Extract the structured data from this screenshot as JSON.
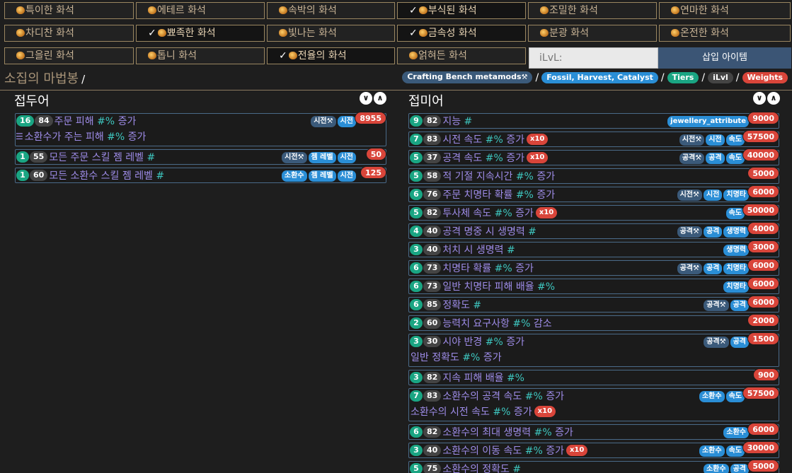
{
  "fossils": [
    {
      "label": "특이한 화석",
      "selected": false
    },
    {
      "label": "에테르 화석",
      "selected": false
    },
    {
      "label": "속박의 화석",
      "selected": false
    },
    {
      "label": "부식된 화석",
      "selected": true
    },
    {
      "label": "조밀한 화석",
      "selected": false
    },
    {
      "label": "연마한 화석",
      "selected": false
    },
    {
      "label": "차디찬 화석",
      "selected": false
    },
    {
      "label": "뾰족한 화석",
      "selected": true
    },
    {
      "label": "빛나는 화석",
      "selected": false
    },
    {
      "label": "금속성 화석",
      "selected": true
    },
    {
      "label": "분광 화석",
      "selected": false
    },
    {
      "label": "온전한 화석",
      "selected": false
    },
    {
      "label": "그을린 화석",
      "selected": false
    },
    {
      "label": "톱니 화석",
      "selected": false
    },
    {
      "label": "전율의 화석",
      "selected": true
    },
    {
      "label": "얽혀든 화석",
      "selected": false
    }
  ],
  "ilvl_placeholder": "iLvL:",
  "insert_label": "삽입 아이템",
  "item_title": "소집의 마법봉",
  "title_sep": "/",
  "breadcrumbs": [
    {
      "label": "Crafting Bench metamods",
      "color": "dark",
      "hammer": true
    },
    {
      "label": "Fossil, Harvest, Catalyst",
      "color": "blue"
    },
    {
      "label": "Tiers",
      "color": "teal"
    },
    {
      "label": "iLvl",
      "color": "gray"
    },
    {
      "label": "Weights",
      "color": "red"
    }
  ],
  "prefix_title": "접두어",
  "suffix_title": "접미어",
  "icons": {
    "expand": "chevron-down-icon",
    "collapse": "chevron-up-icon",
    "fossil": "fossil-icon",
    "hammer": "hammer-icon",
    "list": "list-icon"
  },
  "prefixes": [
    {
      "level": "16",
      "ilvl": "84",
      "lines": [
        {
          "pre": "주문 피해",
          "stat": "#%",
          "post": "증가"
        },
        {
          "pre": "소환수가 주는 피해",
          "stat": "#%",
          "post": "증가",
          "list": true
        }
      ],
      "tags": [
        {
          "t": "시전",
          "dark": true,
          "hammer": true
        },
        {
          "t": "시전"
        }
      ],
      "weight": "8955"
    },
    {
      "level": "1",
      "ilvl": "55",
      "lines": [
        {
          "pre": "모든 주문 스킬 젬 레벨",
          "stat": "#",
          "post": ""
        }
      ],
      "tags": [
        {
          "t": "시전",
          "dark": true,
          "hammer": true
        },
        {
          "t": "젬 레벨"
        },
        {
          "t": "시전"
        }
      ],
      "weight": "50"
    },
    {
      "level": "1",
      "ilvl": "60",
      "lines": [
        {
          "pre": "모든 소환수 스킬 젬 레벨",
          "stat": "#",
          "post": ""
        }
      ],
      "tags": [
        {
          "t": "소환수"
        },
        {
          "t": "젬 레벨"
        },
        {
          "t": "시전"
        }
      ],
      "weight": "125"
    }
  ],
  "suffixes": [
    {
      "level": "9",
      "ilvl": "82",
      "lines": [
        {
          "pre": "지능",
          "stat": "#",
          "post": ""
        }
      ],
      "tags": [
        {
          "t": "jewellery_attribute"
        }
      ],
      "weight": "9000"
    },
    {
      "level": "7",
      "ilvl": "83",
      "lines": [
        {
          "pre": "시전 속도",
          "stat": "#%",
          "post": "증가",
          "x10": "x10"
        }
      ],
      "tags": [
        {
          "t": "시전",
          "dark": true,
          "hammer": true
        },
        {
          "t": "시전"
        },
        {
          "t": "속도"
        }
      ],
      "weight": "57500"
    },
    {
      "level": "5",
      "ilvl": "37",
      "lines": [
        {
          "pre": "공격 속도",
          "stat": "#%",
          "post": "증가",
          "x10": "x10"
        }
      ],
      "tags": [
        {
          "t": "공격",
          "dark": true,
          "hammer": true
        },
        {
          "t": "공격"
        },
        {
          "t": "속도"
        }
      ],
      "weight": "40000"
    },
    {
      "level": "5",
      "ilvl": "58",
      "lines": [
        {
          "pre": "적 기절 지속시간",
          "stat": "#%",
          "post": "증가"
        }
      ],
      "tags": [],
      "weight": "5000"
    },
    {
      "level": "6",
      "ilvl": "76",
      "lines": [
        {
          "pre": "주문 치명타 확률",
          "stat": "#%",
          "post": "증가"
        }
      ],
      "tags": [
        {
          "t": "시전",
          "dark": true,
          "hammer": true
        },
        {
          "t": "시전"
        },
        {
          "t": "치명타"
        }
      ],
      "weight": "6000"
    },
    {
      "level": "5",
      "ilvl": "82",
      "lines": [
        {
          "pre": "투사체 속도",
          "stat": "#%",
          "post": "증가",
          "x10": "x10"
        }
      ],
      "tags": [
        {
          "t": "속도"
        }
      ],
      "weight": "50000"
    },
    {
      "level": "4",
      "ilvl": "40",
      "lines": [
        {
          "pre": "공격 명중 시 생명력",
          "stat": "#",
          "post": ""
        }
      ],
      "tags": [
        {
          "t": "공격",
          "dark": true,
          "hammer": true
        },
        {
          "t": "공격"
        },
        {
          "t": "생명력"
        }
      ],
      "weight": "4000"
    },
    {
      "level": "3",
      "ilvl": "40",
      "lines": [
        {
          "pre": "처치 시 생명력",
          "stat": "#",
          "post": ""
        }
      ],
      "tags": [
        {
          "t": "생명력"
        }
      ],
      "weight": "3000"
    },
    {
      "level": "6",
      "ilvl": "73",
      "lines": [
        {
          "pre": "치명타 확률",
          "stat": "#%",
          "post": "증가"
        }
      ],
      "tags": [
        {
          "t": "공격",
          "dark": true,
          "hammer": true
        },
        {
          "t": "공격"
        },
        {
          "t": "치명타"
        }
      ],
      "weight": "6000"
    },
    {
      "level": "6",
      "ilvl": "73",
      "lines": [
        {
          "pre": "일반 치명타 피해 배율",
          "stat": "#%",
          "post": ""
        }
      ],
      "tags": [
        {
          "t": "치명타"
        }
      ],
      "weight": "6000"
    },
    {
      "level": "6",
      "ilvl": "85",
      "lines": [
        {
          "pre": "정확도",
          "stat": "#",
          "post": ""
        }
      ],
      "tags": [
        {
          "t": "공격",
          "dark": true,
          "hammer": true
        },
        {
          "t": "공격"
        }
      ],
      "weight": "6000"
    },
    {
      "level": "2",
      "ilvl": "60",
      "lines": [
        {
          "pre": "능력치 요구사항",
          "stat": "#%",
          "post": "감소"
        }
      ],
      "tags": [],
      "weight": "2000"
    },
    {
      "level": "3",
      "ilvl": "30",
      "lines": [
        {
          "pre": "시야 반경",
          "stat": "#%",
          "post": "증가"
        },
        {
          "pre": "일반 정확도",
          "stat": "#%",
          "post": "증가"
        }
      ],
      "tags": [
        {
          "t": "공격",
          "dark": true,
          "hammer": true
        },
        {
          "t": "공격"
        }
      ],
      "weight": "1500"
    },
    {
      "level": "3",
      "ilvl": "82",
      "lines": [
        {
          "pre": "지속 피해 배율",
          "stat": "#%",
          "post": ""
        }
      ],
      "tags": [],
      "weight": "900"
    },
    {
      "level": "7",
      "ilvl": "83",
      "lines": [
        {
          "pre": "소환수의 공격 속도",
          "stat": "#%",
          "post": "증가"
        },
        {
          "pre": "소환수의 시전 속도",
          "stat": "#%",
          "post": "증가",
          "x10": "x10"
        }
      ],
      "tags": [
        {
          "t": "소환수"
        },
        {
          "t": "속도"
        }
      ],
      "weight": "57500"
    },
    {
      "level": "6",
      "ilvl": "82",
      "lines": [
        {
          "pre": "소환수의 최대 생명력",
          "stat": "#%",
          "post": "증가"
        }
      ],
      "tags": [
        {
          "t": "소환수"
        }
      ],
      "weight": "6000"
    },
    {
      "level": "3",
      "ilvl": "40",
      "lines": [
        {
          "pre": "소환수의 이동 속도",
          "stat": "#%",
          "post": "증가",
          "x10": "x10"
        }
      ],
      "tags": [
        {
          "t": "소환수"
        },
        {
          "t": "속도"
        }
      ],
      "weight": "30000"
    },
    {
      "level": "5",
      "ilvl": "75",
      "lines": [
        {
          "pre": "소환수의 정확도",
          "stat": "#",
          "post": ""
        }
      ],
      "tags": [
        {
          "t": "소환수"
        },
        {
          "t": "공격"
        }
      ],
      "weight": "5000"
    }
  ]
}
